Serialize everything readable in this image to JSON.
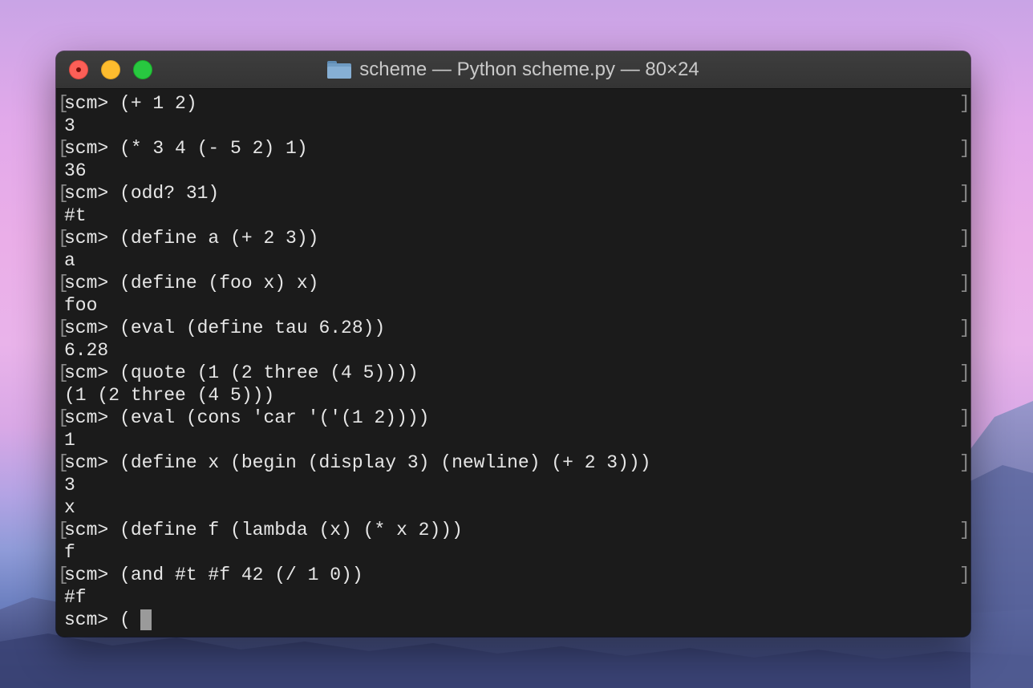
{
  "window": {
    "title": "scheme — Python scheme.py — 80×24",
    "folder_icon": "folder-icon"
  },
  "terminal": {
    "lines": [
      {
        "text": "scm> (+ 1 2)",
        "kind": "input"
      },
      {
        "text": "3",
        "kind": "output"
      },
      {
        "text": "scm> (* 3 4 (- 5 2) 1)",
        "kind": "input"
      },
      {
        "text": "36",
        "kind": "output"
      },
      {
        "text": "scm> (odd? 31)",
        "kind": "input"
      },
      {
        "text": "#t",
        "kind": "output"
      },
      {
        "text": "scm> (define a (+ 2 3))",
        "kind": "input"
      },
      {
        "text": "a",
        "kind": "output"
      },
      {
        "text": "scm> (define (foo x) x)",
        "kind": "input"
      },
      {
        "text": "foo",
        "kind": "output"
      },
      {
        "text": "scm> (eval (define tau 6.28))",
        "kind": "input"
      },
      {
        "text": "6.28",
        "kind": "output"
      },
      {
        "text": "scm> (quote (1 (2 three (4 5))))",
        "kind": "input"
      },
      {
        "text": "(1 (2 three (4 5)))",
        "kind": "output"
      },
      {
        "text": "scm> (eval (cons 'car '('(1 2))))",
        "kind": "input"
      },
      {
        "text": "1",
        "kind": "output"
      },
      {
        "text": "scm> (define x (begin (display 3) (newline) (+ 2 3)))",
        "kind": "input"
      },
      {
        "text": "3",
        "kind": "output"
      },
      {
        "text": "x",
        "kind": "output"
      },
      {
        "text": "scm> (define f (lambda (x) (* x 2)))",
        "kind": "input"
      },
      {
        "text": "f",
        "kind": "output"
      },
      {
        "text": "scm> (and #t #f 42 (/ 1 0))",
        "kind": "input"
      },
      {
        "text": "#f",
        "kind": "output"
      },
      {
        "text": "scm> ( ",
        "kind": "prompt"
      }
    ],
    "bracket_open": "[",
    "bracket_close": "]"
  },
  "colors": {
    "close": "#fc5f57",
    "minimize": "#fdbc2e",
    "maximize": "#28c840",
    "terminal_bg": "#1b1b1b",
    "terminal_fg": "#e6e6e6"
  }
}
